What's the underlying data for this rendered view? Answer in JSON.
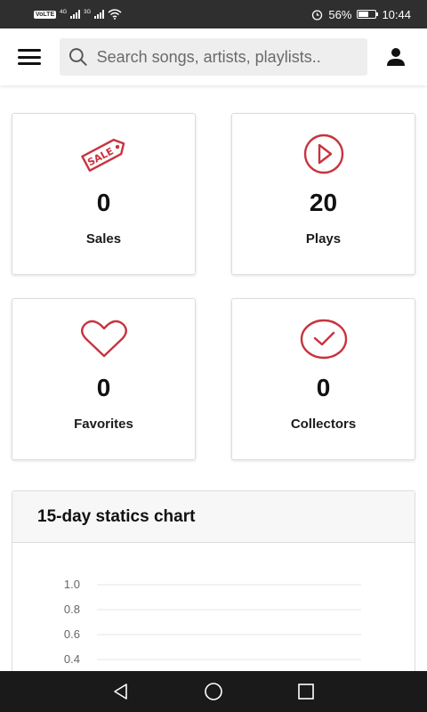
{
  "status_bar": {
    "volte": "VoLTE",
    "sim1_net": "4G",
    "sim2_net": "3G",
    "alarm_icon": "alarm-clock-icon",
    "battery_percent": "56%",
    "battery_level": 0.56,
    "time": "10:44"
  },
  "app_bar": {
    "menu_icon": "hamburger-menu-icon",
    "search_icon": "search-icon",
    "search_placeholder": "Search songs, artists, playlists..",
    "profile_icon": "person-icon"
  },
  "stats": [
    {
      "icon": "sale-tag-icon",
      "value": "0",
      "label": "Sales"
    },
    {
      "icon": "play-circle-icon",
      "value": "20",
      "label": "Plays"
    },
    {
      "icon": "heart-icon",
      "value": "0",
      "label": "Favorites"
    },
    {
      "icon": "check-circle-icon",
      "value": "0",
      "label": "Collectors"
    }
  ],
  "accent_color": "#c8333e",
  "chart": {
    "title": "15-day statics chart"
  },
  "chart_data": {
    "type": "line",
    "title": "15-day statics chart",
    "y_ticks_visible": [
      "1.0",
      "0.8",
      "0.6",
      "0.4"
    ],
    "ylim": [
      0,
      1.0
    ],
    "grid": true,
    "series": []
  },
  "nav_bar": {
    "back_icon": "back-triangle-icon",
    "home_icon": "home-circle-icon",
    "recents_icon": "recents-square-icon"
  }
}
